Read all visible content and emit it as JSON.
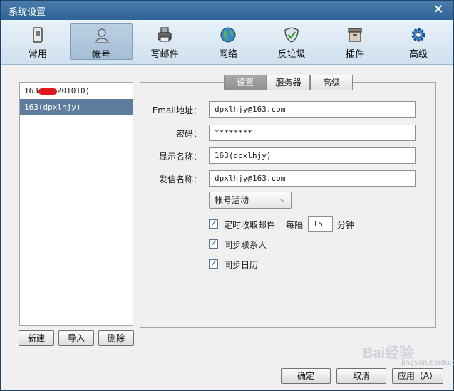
{
  "window": {
    "title": "系统设置"
  },
  "toolbar": [
    {
      "label": "常用",
      "icon": "general-icon"
    },
    {
      "label": "帐号",
      "icon": "account-icon",
      "active": true
    },
    {
      "label": "写邮件",
      "icon": "compose-icon"
    },
    {
      "label": "网络",
      "icon": "network-icon"
    },
    {
      "label": "反垃圾",
      "icon": "antispam-shield-icon"
    },
    {
      "label": "插件",
      "icon": "plugin-box-icon"
    },
    {
      "label": "高级",
      "icon": "advanced-gear-icon"
    }
  ],
  "accounts": [
    {
      "prefix": "163",
      "suffix": "201010)",
      "selected": false
    },
    {
      "label": "163(dpxlhjy)",
      "selected": true
    }
  ],
  "account_buttons": {
    "new": "新建",
    "import": "导入",
    "delete": "删除"
  },
  "tabs": [
    {
      "label": "设置",
      "active": true
    },
    {
      "label": "服务器"
    },
    {
      "label": "高级"
    }
  ],
  "form": {
    "email_label": "Email地址：",
    "email_value": "dpxlhjy@163.com",
    "password_label": "密码：",
    "password_value": "********",
    "display_label": "显示名称：",
    "display_value": "163(dpxlhjy)",
    "sender_label": "发信名称：",
    "sender_value": "dpxlhjy@163.com",
    "status_select": "帐号活动",
    "auto_fetch_label": "定时收取邮件",
    "interval_prefix": "每隔",
    "interval_value": "15",
    "interval_unit": "分钟",
    "sync_contacts_label": "同步联系人",
    "sync_calendar_label": "同步日历"
  },
  "footer": {
    "ok": "确定",
    "cancel": "取消",
    "apply": "应用（A）"
  },
  "watermark": {
    "text": "Bai经验",
    "sub": "jingyan.baidu.com"
  }
}
